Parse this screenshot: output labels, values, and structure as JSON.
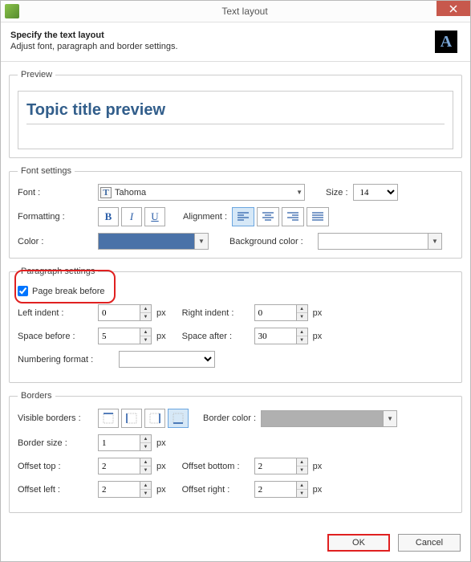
{
  "window": {
    "title": "Text layout"
  },
  "header": {
    "title": "Specify the text layout",
    "subtitle": "Adjust font, paragraph and border settings.",
    "icon_glyph": "A"
  },
  "preview": {
    "legend": "Preview",
    "text": "Topic title preview"
  },
  "font": {
    "legend": "Font settings",
    "font_label": "Font :",
    "font_value": "Tahoma",
    "size_label": "Size :",
    "size_value": "14",
    "formatting_label": "Formatting :",
    "bold": "B",
    "italic": "I",
    "underline": "U",
    "alignment_label": "Alignment :",
    "color_label": "Color :",
    "color_value": "#4a72a8",
    "bgcolor_label": "Background color :",
    "bgcolor_value": "#ffffff"
  },
  "para": {
    "legend": "Paragraph settings",
    "page_break_label": "Page break before",
    "left_indent_label": "Left indent :",
    "left_indent": "0",
    "right_indent_label": "Right indent :",
    "right_indent": "0",
    "space_before_label": "Space before :",
    "space_before": "5",
    "space_after_label": "Space after :",
    "space_after": "30",
    "numbering_label": "Numbering format :",
    "numbering_value": "",
    "px": "px"
  },
  "borders": {
    "legend": "Borders",
    "visible_label": "Visible borders :",
    "color_label": "Border color :",
    "color_value": "#b0b0b0",
    "size_label": "Border size :",
    "size": "1",
    "off_top_label": "Offset top :",
    "off_top": "2",
    "off_bottom_label": "Offset bottom :",
    "off_bottom": "2",
    "off_left_label": "Offset left :",
    "off_left": "2",
    "off_right_label": "Offset right :",
    "off_right": "2",
    "px": "px"
  },
  "footer": {
    "ok": "OK",
    "cancel": "Cancel"
  }
}
